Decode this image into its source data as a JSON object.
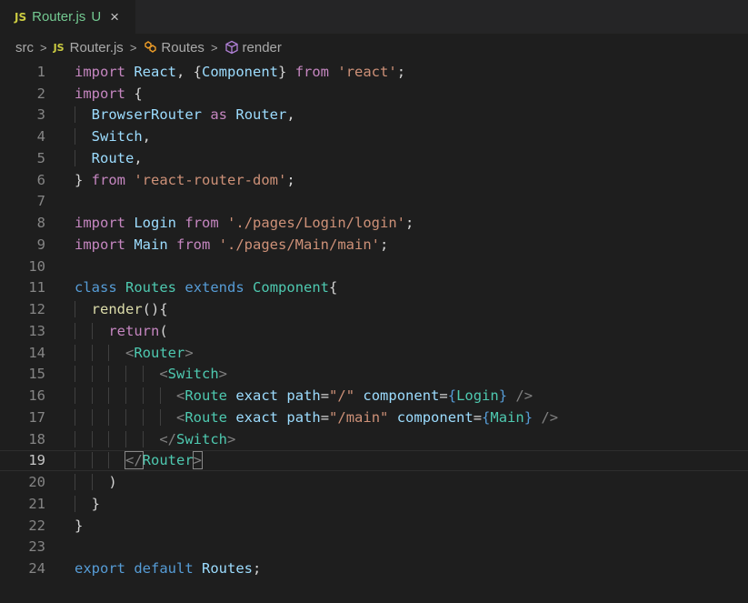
{
  "tab": {
    "badge": "JS",
    "label": "Router.js",
    "status": "U",
    "close": "×"
  },
  "breadcrumb": {
    "folder": "src",
    "file_badge": "JS",
    "file": "Router.js",
    "class_name": "Routes",
    "method_name": "render",
    "separator": ">"
  },
  "editor": {
    "active_line": 19,
    "line_numbers": [
      "1",
      "2",
      "3",
      "4",
      "5",
      "6",
      "7",
      "8",
      "9",
      "10",
      "11",
      "12",
      "13",
      "14",
      "15",
      "16",
      "17",
      "18",
      "19",
      "20",
      "21",
      "22",
      "23",
      "24"
    ]
  },
  "colors": {
    "background": "#1e1e1e",
    "keyword": "#569cd6",
    "control_keyword": "#c586c0",
    "variable": "#9cdcfe",
    "class": "#4ec9b0",
    "string": "#ce9178",
    "function": "#dcdcaa",
    "modified_tab": "#73c991"
  },
  "code": [
    {
      "indent": 0,
      "tokens": [
        [
          "kw2",
          "import"
        ],
        [
          "pun",
          " "
        ],
        [
          "var",
          "React"
        ],
        [
          "pun",
          ", {"
        ],
        [
          "var",
          "Component"
        ],
        [
          "pun",
          "} "
        ],
        [
          "kw2",
          "from"
        ],
        [
          "pun",
          " "
        ],
        [
          "str",
          "'react'"
        ],
        [
          "pun",
          ";"
        ]
      ]
    },
    {
      "indent": 0,
      "tokens": [
        [
          "kw2",
          "import"
        ],
        [
          "pun",
          " {"
        ]
      ]
    },
    {
      "indent": 1,
      "tokens": [
        [
          "var",
          "BrowserRouter"
        ],
        [
          "pun",
          " "
        ],
        [
          "kw2",
          "as"
        ],
        [
          "pun",
          " "
        ],
        [
          "var",
          "Router"
        ],
        [
          "pun",
          ","
        ]
      ]
    },
    {
      "indent": 1,
      "tokens": [
        [
          "var",
          "Switch"
        ],
        [
          "pun",
          ","
        ]
      ]
    },
    {
      "indent": 1,
      "tokens": [
        [
          "var",
          "Route"
        ],
        [
          "pun",
          ","
        ]
      ]
    },
    {
      "indent": 0,
      "tokens": [
        [
          "pun",
          "} "
        ],
        [
          "kw2",
          "from"
        ],
        [
          "pun",
          " "
        ],
        [
          "str",
          "'react-router-dom'"
        ],
        [
          "pun",
          ";"
        ]
      ]
    },
    {
      "indent": 0,
      "tokens": []
    },
    {
      "indent": 0,
      "tokens": [
        [
          "kw2",
          "import"
        ],
        [
          "pun",
          " "
        ],
        [
          "var",
          "Login"
        ],
        [
          "pun",
          " "
        ],
        [
          "kw2",
          "from"
        ],
        [
          "pun",
          " "
        ],
        [
          "str",
          "'./pages/Login/login'"
        ],
        [
          "pun",
          ";"
        ]
      ]
    },
    {
      "indent": 0,
      "tokens": [
        [
          "kw2",
          "import"
        ],
        [
          "pun",
          " "
        ],
        [
          "var",
          "Main"
        ],
        [
          "pun",
          " "
        ],
        [
          "kw2",
          "from"
        ],
        [
          "pun",
          " "
        ],
        [
          "str",
          "'./pages/Main/main'"
        ],
        [
          "pun",
          ";"
        ]
      ]
    },
    {
      "indent": 0,
      "tokens": []
    },
    {
      "indent": 0,
      "tokens": [
        [
          "kw",
          "class"
        ],
        [
          "pun",
          " "
        ],
        [
          "cls",
          "Routes"
        ],
        [
          "pun",
          " "
        ],
        [
          "kw",
          "extends"
        ],
        [
          "pun",
          " "
        ],
        [
          "cls",
          "Component"
        ],
        [
          "pun",
          "{"
        ]
      ]
    },
    {
      "indent": 1,
      "tokens": [
        [
          "fn",
          "render"
        ],
        [
          "pun",
          "(){"
        ]
      ]
    },
    {
      "indent": 2,
      "tokens": [
        [
          "kw2",
          "return"
        ],
        [
          "pun",
          "("
        ]
      ]
    },
    {
      "indent": 3,
      "tokens": [
        [
          "tag",
          "<"
        ],
        [
          "cls",
          "Router"
        ],
        [
          "tag",
          ">"
        ]
      ]
    },
    {
      "indent": 5,
      "tokens": [
        [
          "tag",
          "<"
        ],
        [
          "cls",
          "Switch"
        ],
        [
          "tag",
          ">"
        ]
      ]
    },
    {
      "indent": 6,
      "tokens": [
        [
          "tag",
          "<"
        ],
        [
          "cls",
          "Route"
        ],
        [
          "pun",
          " "
        ],
        [
          "var",
          "exact"
        ],
        [
          "pun",
          " "
        ],
        [
          "var",
          "path"
        ],
        [
          "pun",
          "="
        ],
        [
          "str",
          "\"/\""
        ],
        [
          "pun",
          " "
        ],
        [
          "var",
          "component"
        ],
        [
          "pun",
          "="
        ],
        [
          "kw",
          "{"
        ],
        [
          "cls",
          "Login"
        ],
        [
          "kw",
          "}"
        ],
        [
          "pun",
          " "
        ],
        [
          "tag",
          "/>"
        ]
      ]
    },
    {
      "indent": 6,
      "tokens": [
        [
          "tag",
          "<"
        ],
        [
          "cls",
          "Route"
        ],
        [
          "pun",
          " "
        ],
        [
          "var",
          "exact"
        ],
        [
          "pun",
          " "
        ],
        [
          "var",
          "path"
        ],
        [
          "pun",
          "="
        ],
        [
          "str",
          "\"/main\""
        ],
        [
          "pun",
          " "
        ],
        [
          "var",
          "component"
        ],
        [
          "pun",
          "="
        ],
        [
          "kw",
          "{"
        ],
        [
          "cls",
          "Main"
        ],
        [
          "kw",
          "}"
        ],
        [
          "pun",
          " "
        ],
        [
          "tag",
          "/>"
        ]
      ]
    },
    {
      "indent": 5,
      "tokens": [
        [
          "tag",
          "</"
        ],
        [
          "cls",
          "Switch"
        ],
        [
          "tag",
          ">"
        ]
      ]
    },
    {
      "indent": 3,
      "tokens": [
        [
          "tag",
          "</"
        ],
        [
          "cls",
          "Router"
        ],
        [
          "tag",
          ">"
        ]
      ]
    },
    {
      "indent": 2,
      "tokens": [
        [
          "pun",
          ")"
        ]
      ]
    },
    {
      "indent": 1,
      "tokens": [
        [
          "pun",
          "}"
        ]
      ]
    },
    {
      "indent": 0,
      "tokens": [
        [
          "pun",
          "}"
        ]
      ]
    },
    {
      "indent": 0,
      "tokens": []
    },
    {
      "indent": 0,
      "tokens": [
        [
          "kw",
          "export"
        ],
        [
          "pun",
          " "
        ],
        [
          "kw",
          "default"
        ],
        [
          "pun",
          " "
        ],
        [
          "var",
          "Routes"
        ],
        [
          "pun",
          ";"
        ]
      ]
    }
  ]
}
